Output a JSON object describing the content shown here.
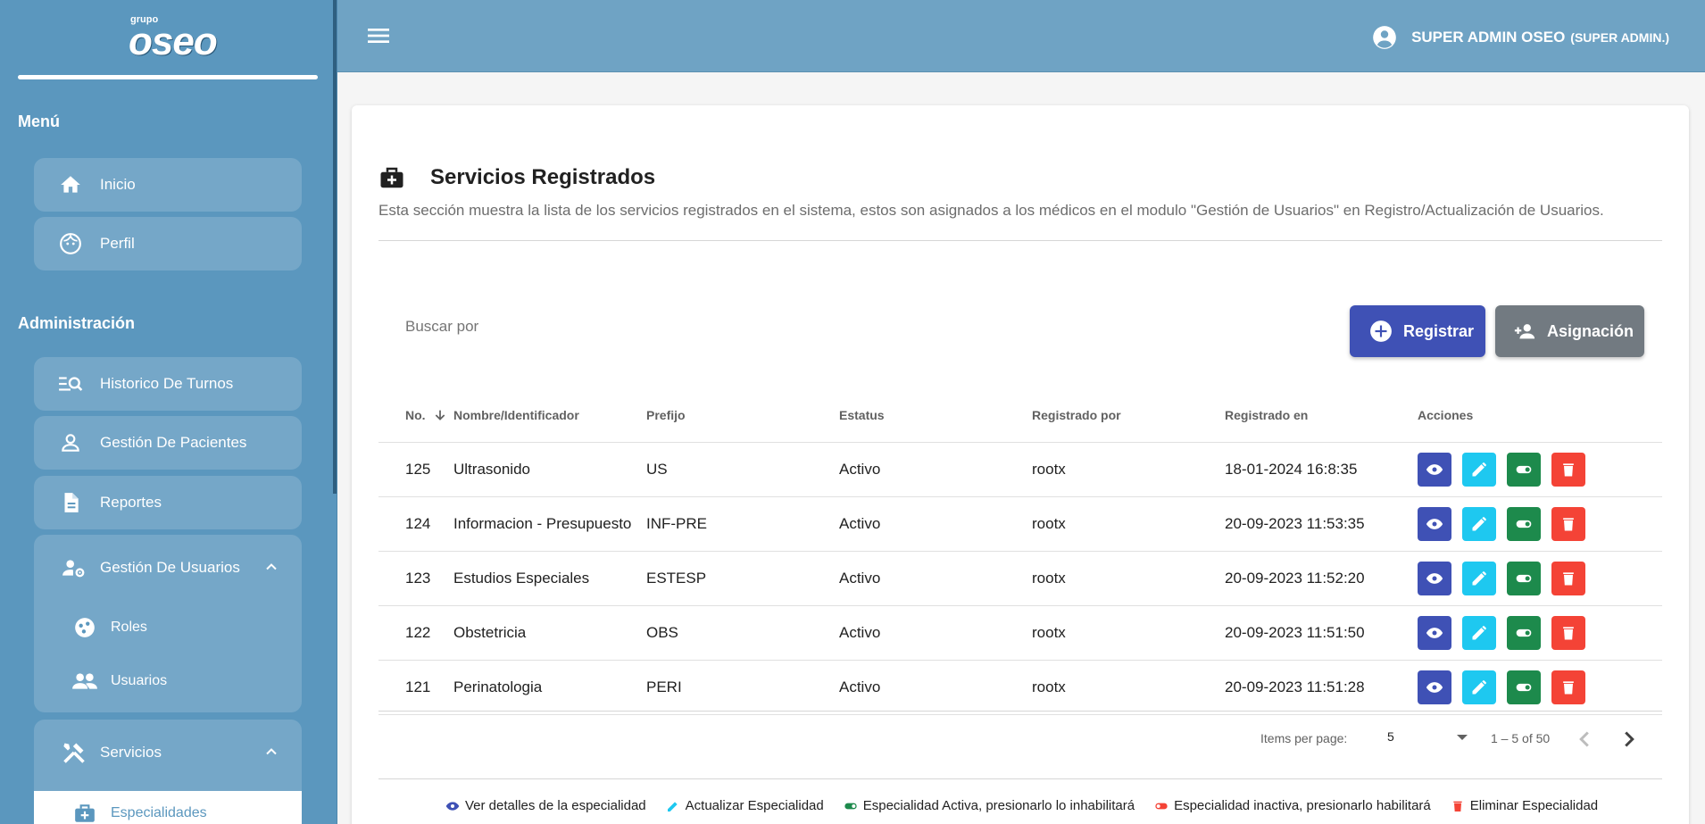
{
  "logo": {
    "small": "grupo",
    "big": "oseo"
  },
  "sidebar": {
    "menu_title": "Menú",
    "menu_items": [
      {
        "label": "Inicio",
        "icon": "home-icon"
      },
      {
        "label": "Perfil",
        "icon": "face-icon"
      }
    ],
    "admin_title": "Administración",
    "admin_items": [
      {
        "label": "Historico De Turnos",
        "icon": "manage-search-icon"
      },
      {
        "label": "Gestión De Pacientes",
        "icon": "person-icon"
      },
      {
        "label": "Reportes",
        "icon": "document-icon"
      }
    ],
    "groups": [
      {
        "label": "Gestión De Usuarios",
        "icon": "manage-accounts-icon",
        "children": [
          {
            "label": "Roles",
            "icon": "roles-icon"
          },
          {
            "label": "Usuarios",
            "icon": "people-icon"
          }
        ]
      },
      {
        "label": "Servicios",
        "icon": "tools-icon",
        "children": [
          {
            "label": "Especialidades",
            "icon": "medical-bag-icon"
          }
        ]
      }
    ]
  },
  "header": {
    "user_name": "SUPER ADMIN OSEO",
    "user_role": "(SUPER ADMIN.)"
  },
  "main": {
    "title": "Servicios Registrados",
    "description": "Esta sección muestra la lista de los servicios registrados en el sistema, estos son asignados a los médicos en el modulo \"Gestión de Usuarios\" en Registro/Actualización de Usuarios.",
    "search_placeholder": "Buscar por",
    "register_label": "Registrar",
    "assign_label": "Asignación",
    "columns": [
      "No.",
      "Nombre/Identificador",
      "Prefijo",
      "Estatus",
      "Registrado por",
      "Registrado en",
      "Acciones"
    ],
    "rows": [
      {
        "no": "125",
        "name": "Ultrasonido",
        "prefix": "US",
        "status": "Activo",
        "by": "rootx",
        "at": "18-01-2024 16:8:35"
      },
      {
        "no": "124",
        "name": "Informacion - Presupuesto",
        "prefix": "INF-PRE",
        "status": "Activo",
        "by": "rootx",
        "at": "20-09-2023 11:53:35"
      },
      {
        "no": "123",
        "name": "Estudios Especiales",
        "prefix": "ESTESP",
        "status": "Activo",
        "by": "rootx",
        "at": "20-09-2023 11:52:20"
      },
      {
        "no": "122",
        "name": "Obstetricia",
        "prefix": "OBS",
        "status": "Activo",
        "by": "rootx",
        "at": "20-09-2023 11:51:50"
      },
      {
        "no": "121",
        "name": "Perinatologia",
        "prefix": "PERI",
        "status": "Activo",
        "by": "rootx",
        "at": "20-09-2023 11:51:28"
      }
    ],
    "paginator": {
      "items_per_page_label": "Items per page:",
      "items_per_page": "5",
      "range": "1 – 5 of 50"
    },
    "legend": [
      {
        "label": "Ver detalles de la especialidad",
        "icon": "eye-icon",
        "color": "#3f51b5"
      },
      {
        "label": "Actualizar Especialidad",
        "icon": "pencil-icon",
        "color": "#1ec8f0"
      },
      {
        "label": "Especialidad Activa, presionarlo lo inhabilitará",
        "icon": "toggle-on-icon",
        "color": "#1d8a4c"
      },
      {
        "label": "Especialidad inactiva, presionarlo habilitará",
        "icon": "toggle-off-icon",
        "color": "#f44336"
      },
      {
        "label": "Eliminar Especialidad",
        "icon": "trash-icon",
        "color": "#f44336"
      }
    ]
  },
  "colors": {
    "sidebar_bg": "#5b97be",
    "topbar_bg": "#6fa3c4",
    "primary": "#3f51b5",
    "cyan": "#1ec8f0",
    "green": "#1d8a4c",
    "red": "#f44336",
    "gray": "#727a81"
  }
}
